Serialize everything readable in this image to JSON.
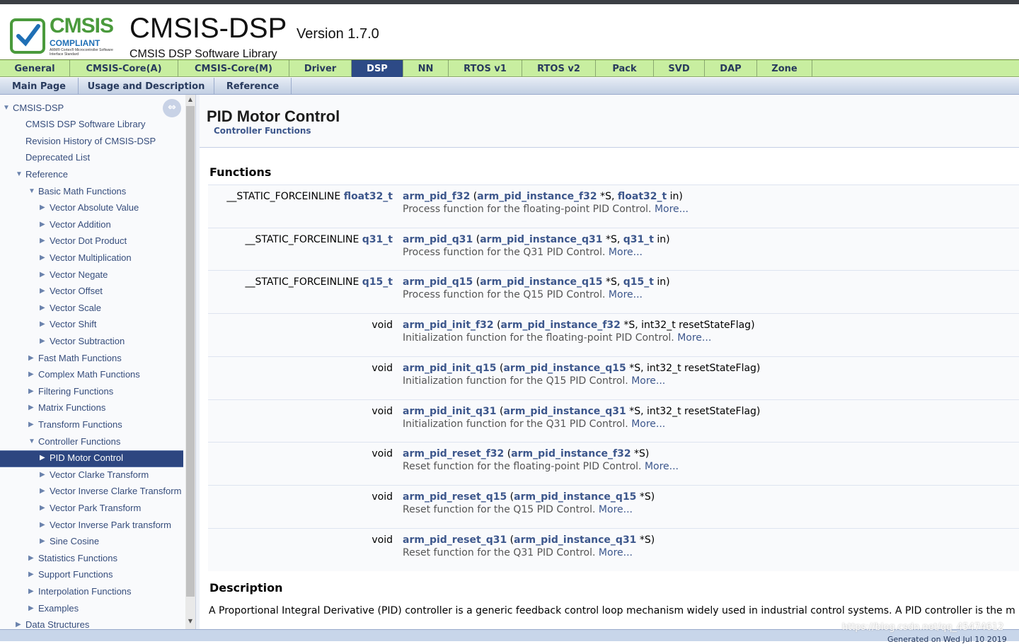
{
  "header": {
    "logo_title": "CMSIS",
    "logo_subtitle": "COMPLIANT",
    "logo_small": "ARM® Cortex® Microcontroller Software Interface Standard",
    "project_name": "CMSIS-DSP",
    "project_version": "Version 1.7.0",
    "project_brief": "CMSIS DSP Software Library"
  },
  "main_tabs": [
    "General",
    "CMSIS-Core(A)",
    "CMSIS-Core(M)",
    "Driver",
    "DSP",
    "NN",
    "RTOS v1",
    "RTOS v2",
    "Pack",
    "SVD",
    "DAP",
    "Zone"
  ],
  "active_main_tab": "DSP",
  "sub_tabs": [
    "Main Page",
    "Usage and Description",
    "Reference"
  ],
  "sidebar": {
    "items": [
      {
        "label": "CMSIS-DSP",
        "arrow": "▼"
      },
      {
        "label": "CMSIS DSP Software Library",
        "arrow": ""
      },
      {
        "label": "Revision History of CMSIS-DSP",
        "arrow": ""
      },
      {
        "label": "Deprecated List",
        "arrow": ""
      },
      {
        "label": "Reference",
        "arrow": "▼"
      },
      {
        "label": "Basic Math Functions",
        "arrow": "▼"
      },
      {
        "label": "Vector Absolute Value",
        "arrow": "▶"
      },
      {
        "label": "Vector Addition",
        "arrow": "▶"
      },
      {
        "label": "Vector Dot Product",
        "arrow": "▶"
      },
      {
        "label": "Vector Multiplication",
        "arrow": "▶"
      },
      {
        "label": "Vector Negate",
        "arrow": "▶"
      },
      {
        "label": "Vector Offset",
        "arrow": "▶"
      },
      {
        "label": "Vector Scale",
        "arrow": "▶"
      },
      {
        "label": "Vector Shift",
        "arrow": "▶"
      },
      {
        "label": "Vector Subtraction",
        "arrow": "▶"
      },
      {
        "label": "Fast Math Functions",
        "arrow": "▶"
      },
      {
        "label": "Complex Math Functions",
        "arrow": "▶"
      },
      {
        "label": "Filtering Functions",
        "arrow": "▶"
      },
      {
        "label": "Matrix Functions",
        "arrow": "▶"
      },
      {
        "label": "Transform Functions",
        "arrow": "▶"
      },
      {
        "label": "Controller Functions",
        "arrow": "▼"
      },
      {
        "label": "PID Motor Control",
        "arrow": "▶"
      },
      {
        "label": "Vector Clarke Transform",
        "arrow": "▶"
      },
      {
        "label": "Vector Inverse Clarke Transform",
        "arrow": "▶"
      },
      {
        "label": "Vector Park Transform",
        "arrow": "▶"
      },
      {
        "label": "Vector Inverse Park transform",
        "arrow": "▶"
      },
      {
        "label": "Sine Cosine",
        "arrow": "▶"
      },
      {
        "label": "Statistics Functions",
        "arrow": "▶"
      },
      {
        "label": "Support Functions",
        "arrow": "▶"
      },
      {
        "label": "Interpolation Functions",
        "arrow": "▶"
      },
      {
        "label": "Examples",
        "arrow": "▶"
      },
      {
        "label": "Data Structures",
        "arrow": "▶"
      }
    ],
    "selected": "PID Motor Control",
    "sync_icon": "sync-arrows-icon"
  },
  "page": {
    "title": "PID Motor Control",
    "ingroup": "Controller Functions",
    "functions_heading": "Functions",
    "functions": [
      {
        "ret_prefix": "__STATIC_FORCEINLINE ",
        "ret_type": "float32_t",
        "name": "arm_pid_f32",
        "p_open": " (",
        "arg_type": "arm_pid_instance_f32",
        "arg_mid": " *S, ",
        "arg2_type": "float32_t",
        "arg_end": " in)",
        "desc": "Process function for the floating-point PID Control. ",
        "more": "More..."
      },
      {
        "ret_prefix": "__STATIC_FORCEINLINE ",
        "ret_type": "q31_t",
        "name": "arm_pid_q31",
        "p_open": " (",
        "arg_type": "arm_pid_instance_q31",
        "arg_mid": " *S, ",
        "arg2_type": "q31_t",
        "arg_end": " in)",
        "desc": "Process function for the Q31 PID Control. ",
        "more": "More..."
      },
      {
        "ret_prefix": "__STATIC_FORCEINLINE ",
        "ret_type": "q15_t",
        "name": "arm_pid_q15",
        "p_open": " (",
        "arg_type": "arm_pid_instance_q15",
        "arg_mid": " *S, ",
        "arg2_type": "q15_t",
        "arg_end": " in)",
        "desc": "Process function for the Q15 PID Control. ",
        "more": "More..."
      },
      {
        "ret_prefix": "void",
        "ret_type": "",
        "name": "arm_pid_init_f32",
        "p_open": " (",
        "arg_type": "arm_pid_instance_f32",
        "arg_mid": " *S, int32_t resetStateFlag)",
        "arg2_type": "",
        "arg_end": "",
        "desc": "Initialization function for the floating-point PID Control. ",
        "more": "More..."
      },
      {
        "ret_prefix": "void",
        "ret_type": "",
        "name": "arm_pid_init_q15",
        "p_open": " (",
        "arg_type": "arm_pid_instance_q15",
        "arg_mid": " *S, int32_t resetStateFlag)",
        "arg2_type": "",
        "arg_end": "",
        "desc": "Initialization function for the Q15 PID Control. ",
        "more": "More..."
      },
      {
        "ret_prefix": "void",
        "ret_type": "",
        "name": "arm_pid_init_q31",
        "p_open": " (",
        "arg_type": "arm_pid_instance_q31",
        "arg_mid": " *S, int32_t resetStateFlag)",
        "arg2_type": "",
        "arg_end": "",
        "desc": "Initialization function for the Q31 PID Control. ",
        "more": "More..."
      },
      {
        "ret_prefix": "void",
        "ret_type": "",
        "name": "arm_pid_reset_f32",
        "p_open": " (",
        "arg_type": "arm_pid_instance_f32",
        "arg_mid": " *S)",
        "arg2_type": "",
        "arg_end": "",
        "desc": "Reset function for the floating-point PID Control. ",
        "more": "More..."
      },
      {
        "ret_prefix": "void",
        "ret_type": "",
        "name": "arm_pid_reset_q15",
        "p_open": " (",
        "arg_type": "arm_pid_instance_q15",
        "arg_mid": " *S)",
        "arg2_type": "",
        "arg_end": "",
        "desc": "Reset function for the Q15 PID Control. ",
        "more": "More..."
      },
      {
        "ret_prefix": "void",
        "ret_type": "",
        "name": "arm_pid_reset_q31",
        "p_open": " (",
        "arg_type": "arm_pid_instance_q31",
        "arg_mid": " *S)",
        "arg2_type": "",
        "arg_end": "",
        "desc": "Reset function for the Q31 PID Control. ",
        "more": "More..."
      }
    ],
    "description_heading": "Description",
    "description_text": "A Proportional Integral Derivative (PID) controller is a generic feedback control loop mechanism widely used in industrial control systems. A PID controller is the m"
  },
  "footer": {
    "generated": "Generated on Wed Jul 10 2019",
    "watermark": "https://blog.csdn.net/qq_45474612"
  },
  "colors": {
    "link": "#3d578c",
    "main_tab_bg": "#c8eea0",
    "active_tab_bg": "#2d4a86",
    "nav_selected_bg": "#2d4680"
  }
}
